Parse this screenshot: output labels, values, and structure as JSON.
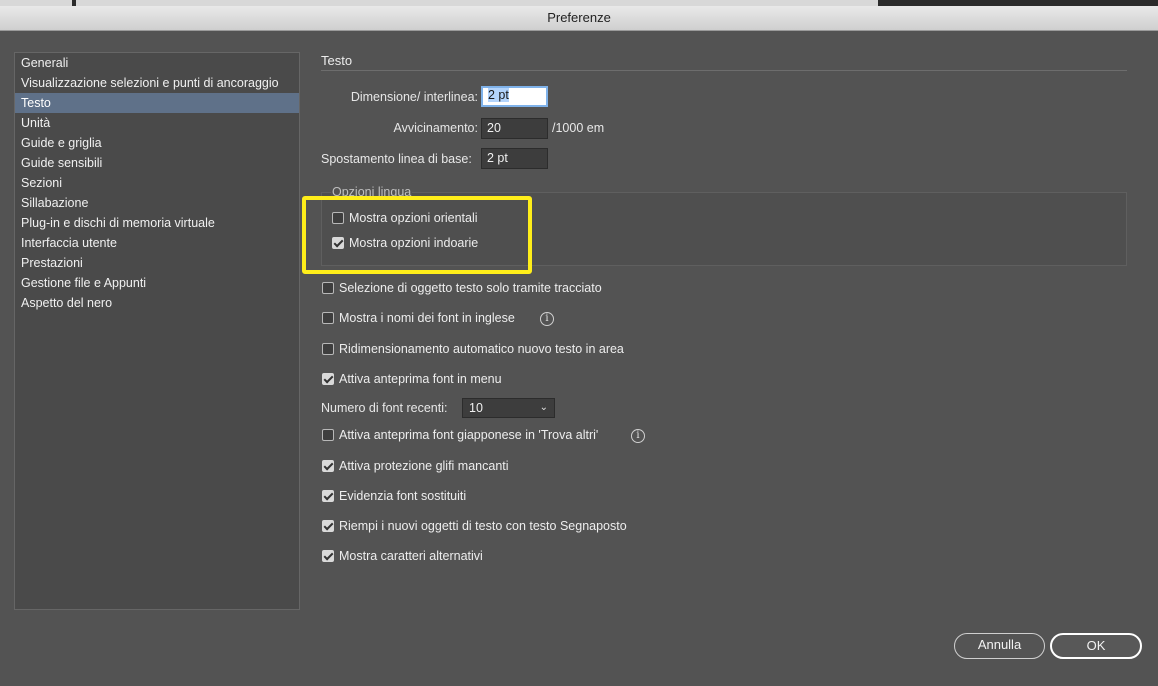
{
  "window": {
    "title": "Preferenze"
  },
  "sidebar": {
    "items": [
      {
        "label": "Generali"
      },
      {
        "label": "Visualizzazione selezioni e punti di ancoraggio"
      },
      {
        "label": "Testo",
        "selected": true
      },
      {
        "label": "Unità"
      },
      {
        "label": "Guide e griglia"
      },
      {
        "label": "Guide sensibili"
      },
      {
        "label": "Sezioni"
      },
      {
        "label": "Sillabazione"
      },
      {
        "label": "Plug-in e dischi di memoria virtuale"
      },
      {
        "label": "Interfaccia utente"
      },
      {
        "label": "Prestazioni"
      },
      {
        "label": "Gestione file e Appunti"
      },
      {
        "label": "Aspetto del nero"
      }
    ]
  },
  "main": {
    "section_title": "Testo",
    "size_leading": {
      "label": "Dimensione/ interlinea:",
      "value": "2 pt"
    },
    "tracking": {
      "label": "Avvicinamento:",
      "value": "20",
      "unit": "/1000 em"
    },
    "baseline_shift": {
      "label": "Spostamento linea di base:",
      "value": "2 pt"
    },
    "language_options": {
      "label": "Opzioni lingua",
      "east_asian": {
        "label": "Mostra opzioni orientali",
        "checked": false
      },
      "indic": {
        "label": "Mostra opzioni indoarie",
        "checked": true
      }
    },
    "options": [
      {
        "label": "Selezione di oggetto testo solo tramite tracciato",
        "checked": false
      },
      {
        "label": "Mostra i nomi dei font in inglese",
        "checked": false,
        "info": true
      },
      {
        "label": "Ridimensionamento automatico nuovo testo in area",
        "checked": false
      },
      {
        "label": "Attiva anteprima font in menu",
        "checked": true
      }
    ],
    "recent_fonts": {
      "label": "Numero di font recenti:",
      "value": "10"
    },
    "options2": [
      {
        "label": "Attiva anteprima font giapponese in 'Trova altri'",
        "checked": false,
        "info": true
      },
      {
        "label": "Attiva protezione glifi mancanti",
        "checked": true
      },
      {
        "label": "Evidenzia font sostituiti",
        "checked": true
      },
      {
        "label": "Riempi i nuovi oggetti di testo con testo Segnaposto",
        "checked": true
      },
      {
        "label": "Mostra caratteri alternativi",
        "checked": true
      }
    ],
    "info_glyph": "i"
  },
  "buttons": {
    "cancel": "Annulla",
    "ok": "OK"
  },
  "colors": {
    "highlight": "#ffee1a",
    "selection": "#5f7189",
    "background": "#535353"
  }
}
